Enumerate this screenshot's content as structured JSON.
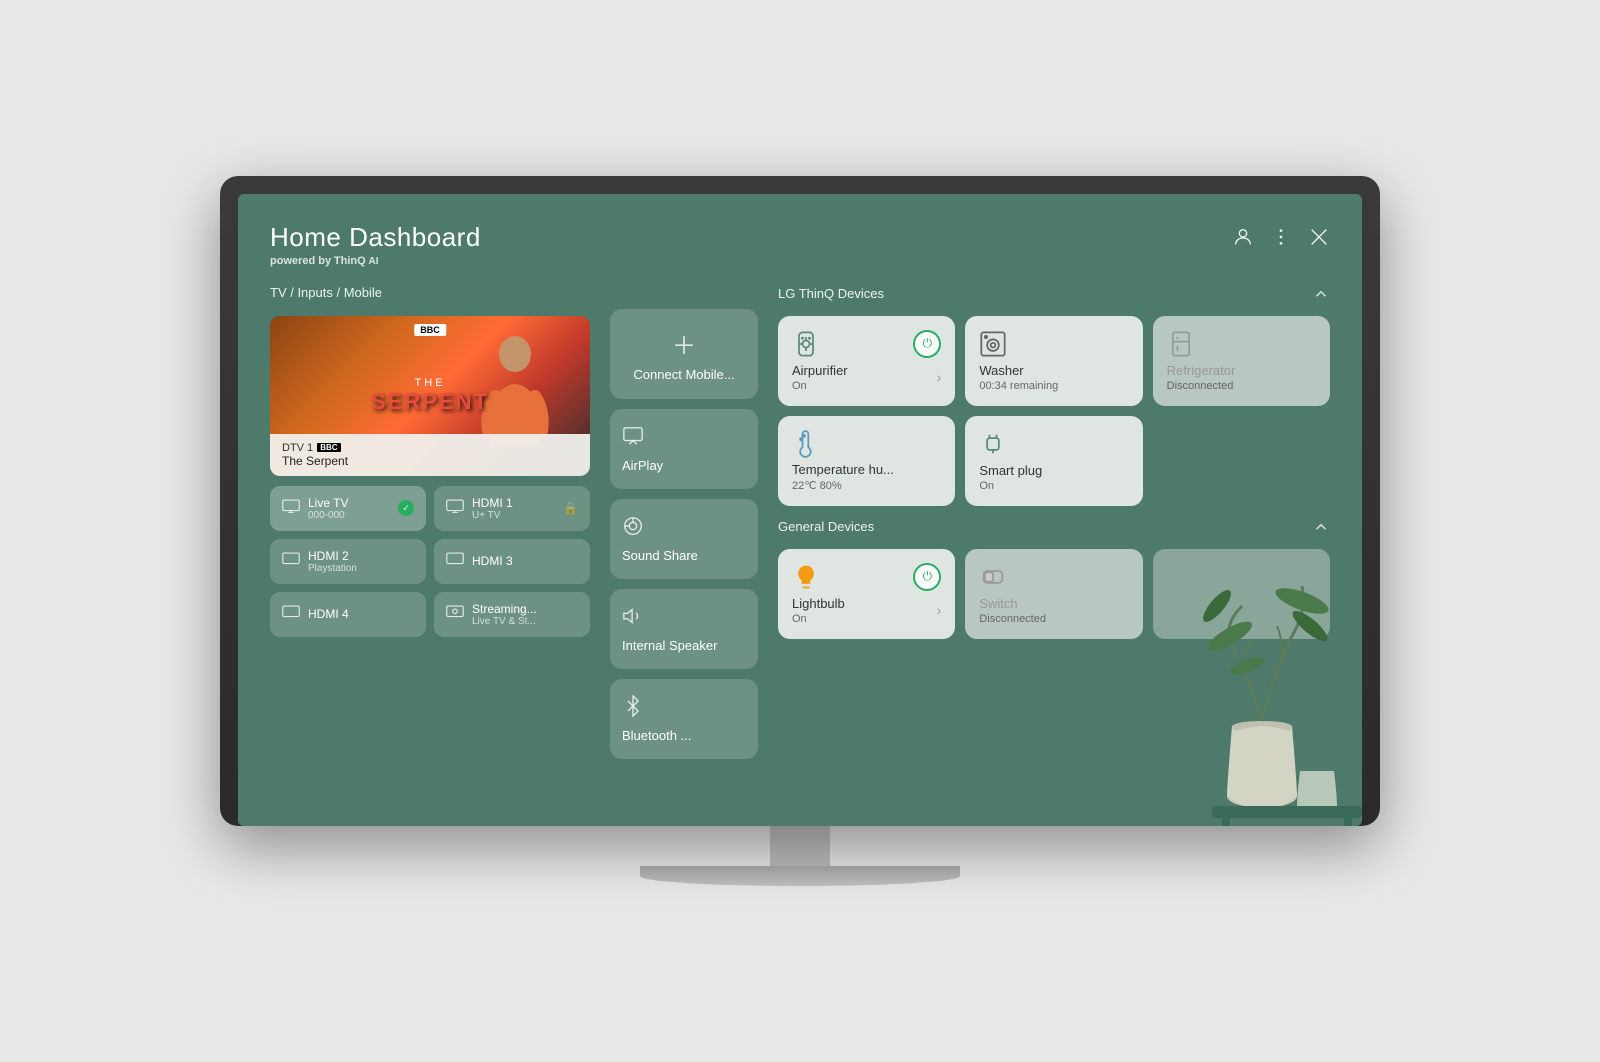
{
  "header": {
    "title": "Home Dashboard",
    "subtitle_pre": "powered by",
    "subtitle_brand": "ThinQ",
    "subtitle_ai": "AI"
  },
  "tv_inputs_section": {
    "label": "TV / Inputs / Mobile",
    "preview": {
      "channel": "DTV 1",
      "show": "The Serpent",
      "bbc": "BBC"
    },
    "inputs": [
      {
        "id": "live-tv",
        "name": "Live TV",
        "sub": "000-000",
        "active": true,
        "locked": false
      },
      {
        "id": "hdmi1",
        "name": "HDMI 1",
        "sub": "U+ TV",
        "active": false,
        "locked": true
      },
      {
        "id": "hdmi2",
        "name": "HDMI 2",
        "sub": "Playstation",
        "active": false,
        "locked": false
      },
      {
        "id": "hdmi3",
        "name": "HDMI 3",
        "sub": "",
        "active": false,
        "locked": false
      },
      {
        "id": "hdmi4",
        "name": "HDMI 4",
        "sub": "",
        "active": false,
        "locked": false
      },
      {
        "id": "streaming",
        "name": "Streaming...",
        "sub": "Live TV & St...",
        "active": false,
        "locked": false
      }
    ]
  },
  "mobile_actions": [
    {
      "id": "connect-mobile",
      "label": "Connect Mobile...",
      "icon": "plus"
    },
    {
      "id": "airplay",
      "label": "AirPlay",
      "icon": "airplay"
    },
    {
      "id": "sound-share",
      "label": "Sound Share",
      "icon": "sound-share"
    },
    {
      "id": "internal-speaker",
      "label": "Internal Speaker",
      "icon": "speaker"
    },
    {
      "id": "bluetooth",
      "label": "Bluetooth ...",
      "icon": "bluetooth"
    }
  ],
  "thinq_section": {
    "label": "LG ThinQ Devices",
    "devices": [
      {
        "id": "airpurifier",
        "name": "Airpurifier",
        "status": "On",
        "icon": "airpurifier",
        "power": true,
        "disconnected": false
      },
      {
        "id": "washer",
        "name": "Washer",
        "status": "00:34 remaining",
        "icon": "washer",
        "power": null,
        "disconnected": false
      },
      {
        "id": "refrigerator",
        "name": "Refrigerator",
        "status": "Disconnected",
        "icon": "refrigerator",
        "power": null,
        "disconnected": true
      },
      {
        "id": "temperature",
        "name": "Temperature hu...",
        "status": "22℃ 80%",
        "icon": "temperature",
        "power": null,
        "disconnected": false
      },
      {
        "id": "smartplug",
        "name": "Smart plug",
        "status": "On",
        "icon": "smartplug",
        "power": null,
        "disconnected": false
      }
    ]
  },
  "general_section": {
    "label": "General Devices",
    "devices": [
      {
        "id": "lightbulb",
        "name": "Lightbulb",
        "status": "On",
        "icon": "lightbulb",
        "power": true,
        "disconnected": false
      },
      {
        "id": "switch",
        "name": "Switch",
        "status": "Disconnected",
        "icon": "switch",
        "power": null,
        "disconnected": true
      }
    ]
  }
}
